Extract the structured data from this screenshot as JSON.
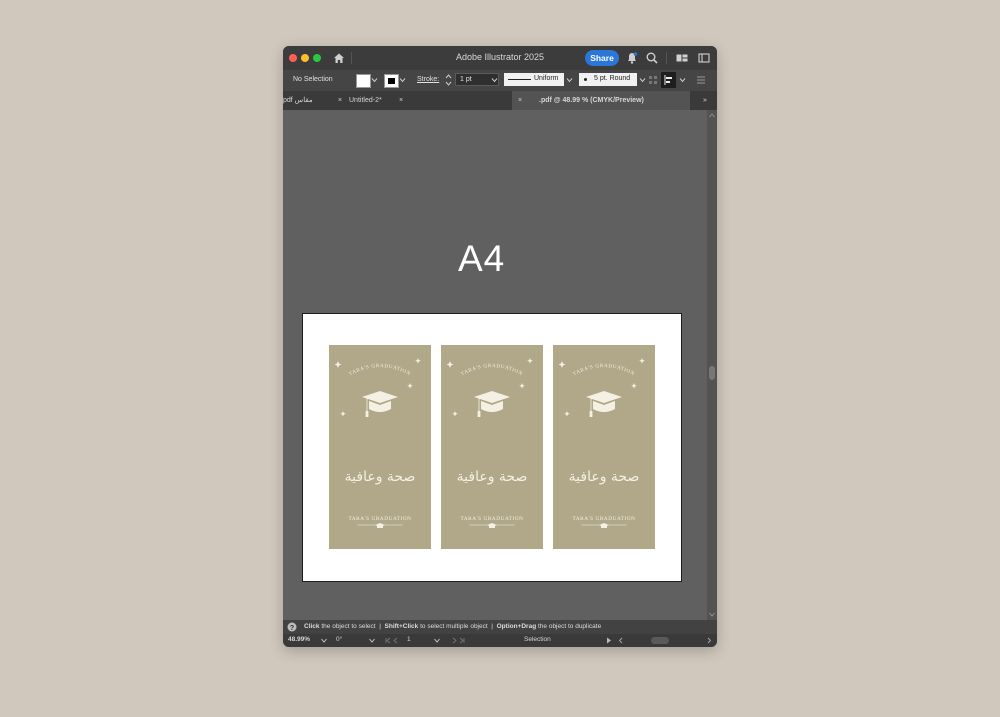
{
  "app": {
    "title": "Adobe Illustrator 2025",
    "share_label": "Share",
    "icons": [
      "home-icon",
      "notification-bell-icon",
      "search-icon",
      "workspace-icon",
      "panel-toggle-icon"
    ]
  },
  "control_bar": {
    "selection": "No Selection",
    "stroke_label": "Stroke:",
    "stroke_value": "1 pt",
    "profile": "Uniform",
    "brush": "5 pt. Round"
  },
  "tabs": [
    {
      "label": "مقاس pdf"
    },
    {
      "label": "Untitled-2*"
    },
    {
      "label": ".pdf @ 48.99 % (CMYK/Preview)"
    }
  ],
  "canvas": {
    "label": "A4",
    "cards": [
      {
        "top_text": "TARA'S GRADUATION",
        "arabic": "صحة وعافية",
        "bottom_text": "TARA'S GRADUATION"
      },
      {
        "top_text": "TARA'S GRADUATION",
        "arabic": "صحة وعافية",
        "bottom_text": "TARA'S GRADUATION"
      },
      {
        "top_text": "TARA'S GRADUATION",
        "arabic": "صحة وعافية",
        "bottom_text": "TARA'S GRADUATION"
      }
    ]
  },
  "status": {
    "hint1_bold": "Click",
    "hint1_rest": "the object to select",
    "hint2_bold": "Shift+Click",
    "hint2_rest": "to select multiple object",
    "hint3_bold": "Option+Drag",
    "hint3_rest": "the object to duplicate",
    "separator": "|"
  },
  "bottom": {
    "zoom": "48.99%",
    "rotation": "0°",
    "artboard": "1",
    "tool": "Selection"
  },
  "colors": {
    "card": "#b0a889",
    "card_ink": "#f4f0e4",
    "accent": "#2b77d8"
  }
}
